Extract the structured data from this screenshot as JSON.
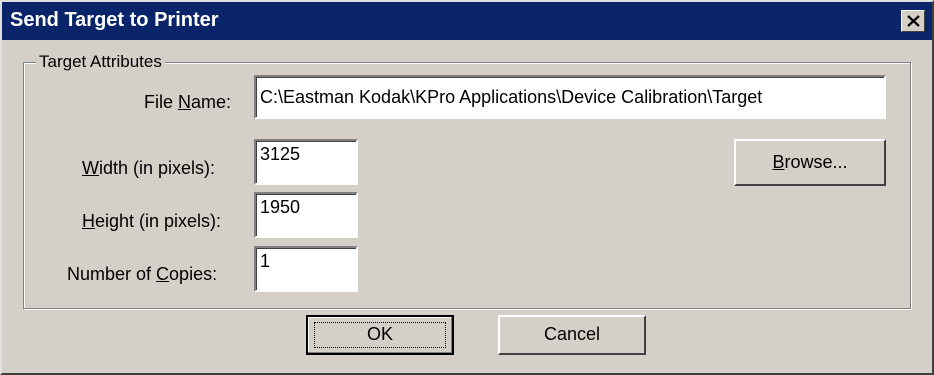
{
  "window": {
    "title": "Send Target to Printer",
    "close_label": "×"
  },
  "group": {
    "label": "Target Attributes"
  },
  "fields": {
    "file_name": {
      "label_pre": "File ",
      "label_mnemonic": "N",
      "label_post": "ame:",
      "value": "C:\\Eastman Kodak\\KPro Applications\\Device Calibration\\Target"
    },
    "width": {
      "label_pre": "",
      "label_mnemonic": "W",
      "label_post": "idth (in pixels):",
      "value": "3125"
    },
    "height": {
      "label_pre": "",
      "label_mnemonic": "H",
      "label_post": "eight (in pixels):",
      "value": "1950"
    },
    "copies": {
      "label_pre": "Number of ",
      "label_mnemonic": "C",
      "label_post": "opies:",
      "value": "1"
    }
  },
  "buttons": {
    "browse": {
      "mnemonic": "B",
      "rest": "rowse..."
    },
    "ok": "OK",
    "cancel": "Cancel"
  },
  "icons": {
    "close": "close-icon"
  }
}
